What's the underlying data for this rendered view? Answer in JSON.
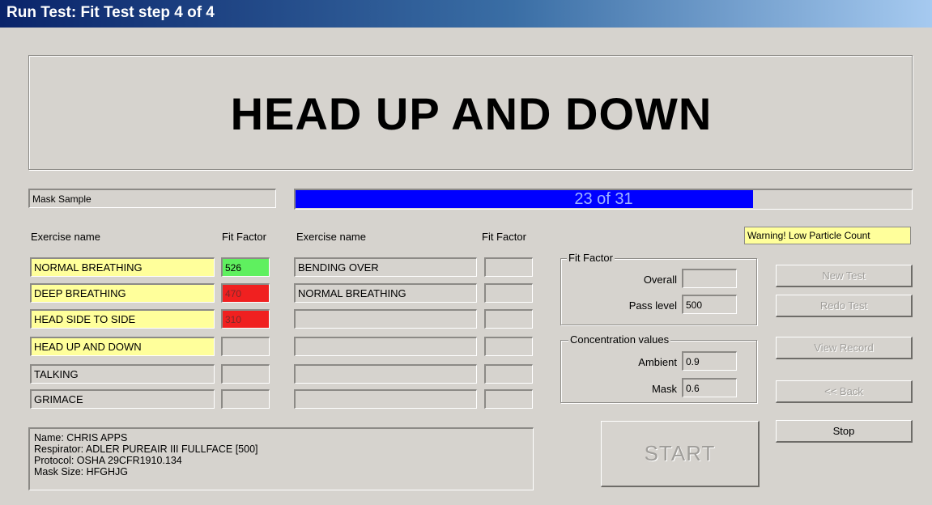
{
  "window": {
    "title": "Run Test: Fit Test step 4 of 4"
  },
  "headline": "HEAD UP AND DOWN",
  "sample_label": "Mask Sample",
  "progress": {
    "text": "23 of 31",
    "current": 23,
    "total": 31
  },
  "warning": "Warning! Low Particle Count",
  "left_table": {
    "col_exercise": "Exercise name",
    "col_fit": "Fit Factor",
    "rows": [
      {
        "name": "NORMAL BREATHING",
        "fit": "526",
        "name_state": "highlight",
        "fit_state": "pass"
      },
      {
        "name": "DEEP BREATHING",
        "fit": "470",
        "name_state": "highlight",
        "fit_state": "fail"
      },
      {
        "name": "HEAD SIDE TO SIDE",
        "fit": "310",
        "name_state": "highlight",
        "fit_state": "fail"
      },
      {
        "name": "HEAD UP AND DOWN",
        "fit": "",
        "name_state": "highlight",
        "fit_state": "empty"
      },
      {
        "name": "TALKING",
        "fit": "",
        "name_state": "normal",
        "fit_state": "empty"
      },
      {
        "name": "GRIMACE",
        "fit": "",
        "name_state": "normal",
        "fit_state": "empty"
      }
    ]
  },
  "right_table": {
    "col_exercise": "Exercise name",
    "col_fit": "Fit Factor",
    "rows": [
      {
        "name": "BENDING OVER",
        "fit": ""
      },
      {
        "name": "NORMAL BREATHING",
        "fit": ""
      },
      {
        "name": "",
        "fit": ""
      },
      {
        "name": "",
        "fit": ""
      },
      {
        "name": "",
        "fit": ""
      },
      {
        "name": "",
        "fit": ""
      }
    ]
  },
  "fit_factor_group": {
    "title": "Fit Factor",
    "overall_label": "Overall",
    "overall_value": "",
    "pass_label": "Pass level",
    "pass_value": "500"
  },
  "concentration_group": {
    "title": "Concentration values",
    "ambient_label": "Ambient",
    "ambient_value": "0.9",
    "mask_label": "Mask",
    "mask_value": "0.6"
  },
  "buttons": {
    "new_test": "New Test",
    "redo_test": "Redo Test",
    "view_record": "View Record",
    "back": "<< Back",
    "stop": "Stop",
    "start": "START"
  },
  "info": {
    "name": "Name: CHRIS APPS",
    "respirator": "Respirator: ADLER PUREAIR III FULLFACE [500]",
    "protocol": "Protocol: OSHA 29CFR1910.134",
    "mask_size": "Mask Size: HFGHJG"
  },
  "colors": {
    "highlight": "#ffff9b",
    "pass": "#5ff05f",
    "fail": "#f02020",
    "progress": "#0000ff"
  }
}
